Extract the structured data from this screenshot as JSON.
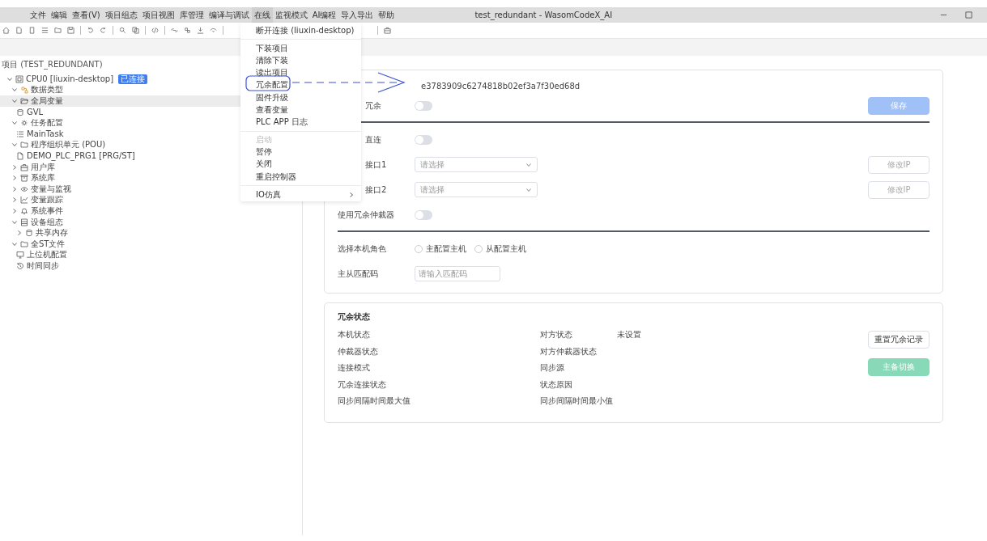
{
  "window": {
    "title": "test_redundant - WasomCodeX_AI"
  },
  "menu_bar": [
    {
      "label": "文件",
      "selected": false
    },
    {
      "label": "编辑",
      "selected": false
    },
    {
      "label": "查看(V)",
      "selected": false
    },
    {
      "label": "项目组态",
      "selected": false
    },
    {
      "label": "项目视图",
      "selected": false
    },
    {
      "label": "库管理",
      "selected": false
    },
    {
      "label": "编译与调试",
      "selected": false
    },
    {
      "label": "在线",
      "selected": true
    },
    {
      "label": "监视模式",
      "selected": false
    },
    {
      "label": "AI编程",
      "selected": false
    },
    {
      "label": "导入导出",
      "selected": false
    },
    {
      "label": "帮助",
      "selected": false
    }
  ],
  "online_menu": {
    "groups": [
      [
        {
          "label": "断开连接 (liuxin-desktop)",
          "disabled": false,
          "submenu": false
        }
      ],
      [
        {
          "label": "下装项目",
          "disabled": false,
          "submenu": false
        },
        {
          "label": "清除下装",
          "disabled": false,
          "submenu": false
        },
        {
          "label": "读出项目",
          "disabled": false,
          "submenu": false
        },
        {
          "label": "冗余配置",
          "disabled": false,
          "submenu": false
        },
        {
          "label": "固件升级",
          "disabled": false,
          "submenu": false
        },
        {
          "label": "查看变量",
          "disabled": false,
          "submenu": false
        },
        {
          "label": "PLC APP 日志",
          "disabled": false,
          "submenu": false
        }
      ],
      [
        {
          "label": "启动",
          "disabled": true,
          "submenu": false
        },
        {
          "label": "暂停",
          "disabled": false,
          "submenu": false
        },
        {
          "label": "关闭",
          "disabled": false,
          "submenu": false
        },
        {
          "label": "重启控制器",
          "disabled": false,
          "submenu": false
        }
      ],
      [
        {
          "label": "IO仿真",
          "disabled": false,
          "submenu": true
        }
      ]
    ]
  },
  "sidebar": {
    "header": "项目 (TEST_REDUNDANT)",
    "tree": [
      {
        "label": "CPU0 [liuxin-desktop]",
        "kind": "cpu",
        "badge": "已连接",
        "expanded": true,
        "selected": false,
        "children": [
          {
            "label": "数据类型",
            "kind": "types",
            "expanded": true,
            "selected": false
          },
          {
            "label": "全局变量",
            "kind": "folder-open",
            "expanded": true,
            "selected": true,
            "children": [
              {
                "label": "GVL",
                "kind": "database",
                "selected": false
              }
            ]
          },
          {
            "label": "任务配置",
            "kind": "gear",
            "expanded": true,
            "selected": false,
            "children": [
              {
                "label": "MainTask",
                "kind": "list",
                "selected": false
              }
            ]
          },
          {
            "label": "程序组织单元 (POU)",
            "kind": "folder",
            "expanded": true,
            "selected": false,
            "children": [
              {
                "label": "DEMO_PLC_PRG1 [PRG/ST]",
                "kind": "file",
                "selected": false
              }
            ]
          },
          {
            "label": "用户库",
            "kind": "toolbox",
            "expanded": false,
            "selected": false
          },
          {
            "label": "系统库",
            "kind": "archive",
            "expanded": false,
            "selected": false
          },
          {
            "label": "变量与监视",
            "kind": "eye",
            "expanded": false,
            "selected": false
          },
          {
            "label": "变量跟踪",
            "kind": "chart",
            "expanded": false,
            "selected": false
          },
          {
            "label": "系统事件",
            "kind": "bell",
            "expanded": false,
            "selected": false
          },
          {
            "label": "设备组态",
            "kind": "rack",
            "expanded": true,
            "selected": false,
            "children": [
              {
                "label": "共享内存",
                "kind": "database",
                "expanded": false,
                "selected": false
              }
            ]
          },
          {
            "label": "全ST文件",
            "kind": "folder",
            "expanded": true,
            "selected": false,
            "children": [
              {
                "label": "上位机配置",
                "kind": "monitor",
                "selected": false
              },
              {
                "label": "时间同步",
                "kind": "clock",
                "selected": false
              }
            ]
          }
        ]
      }
    ]
  },
  "config_card": {
    "device_id": "e3783909c6274818b02ef3a7f30ed68d",
    "rows": [
      {
        "kind": "toggle",
        "label": "冗余",
        "covered": true,
        "on": false,
        "button": {
          "label": "保存",
          "kind": "primary",
          "disabled": true
        }
      },
      {
        "kind": "divider"
      },
      {
        "kind": "toggle",
        "label": "直连",
        "covered": true,
        "on": false
      },
      {
        "kind": "select",
        "label": "接口1",
        "covered": true,
        "placeholder": "请选择",
        "button": {
          "label": "修改IP",
          "kind": "plain",
          "disabled": true
        }
      },
      {
        "kind": "select",
        "label": "接口2",
        "covered": true,
        "placeholder": "请选择",
        "button": {
          "label": "修改IP",
          "kind": "plain",
          "disabled": true
        }
      },
      {
        "kind": "toggle",
        "label": "使用冗余仲裁器",
        "on": false
      },
      {
        "kind": "divider"
      },
      {
        "kind": "radio",
        "label": "选择本机角色",
        "options": [
          {
            "label": "主配置主机",
            "selected": false
          },
          {
            "label": "从配置主机",
            "selected": false
          }
        ]
      },
      {
        "kind": "input",
        "label": "主从匹配码",
        "placeholder": "请输入匹配码"
      }
    ]
  },
  "status_card": {
    "title": "冗余状态",
    "columns": [
      [
        {
          "label": "本机状态"
        },
        {
          "label": "仲裁器状态"
        },
        {
          "label": "连接模式"
        },
        {
          "label": "冗余连接状态"
        },
        {
          "label": "同步间隔时间最大值"
        }
      ],
      [
        {
          "label": "对方状态",
          "value": "未设置"
        },
        {
          "label": "对方仲裁器状态"
        },
        {
          "label": "同步源"
        },
        {
          "label": "状态原因"
        },
        {
          "label": "同步间隔时间最小值"
        }
      ]
    ],
    "buttons": [
      {
        "label": "重置冗余记录",
        "kind": "plain",
        "disabled": false
      },
      {
        "label": "主备切换",
        "kind": "success",
        "disabled": true
      }
    ]
  }
}
